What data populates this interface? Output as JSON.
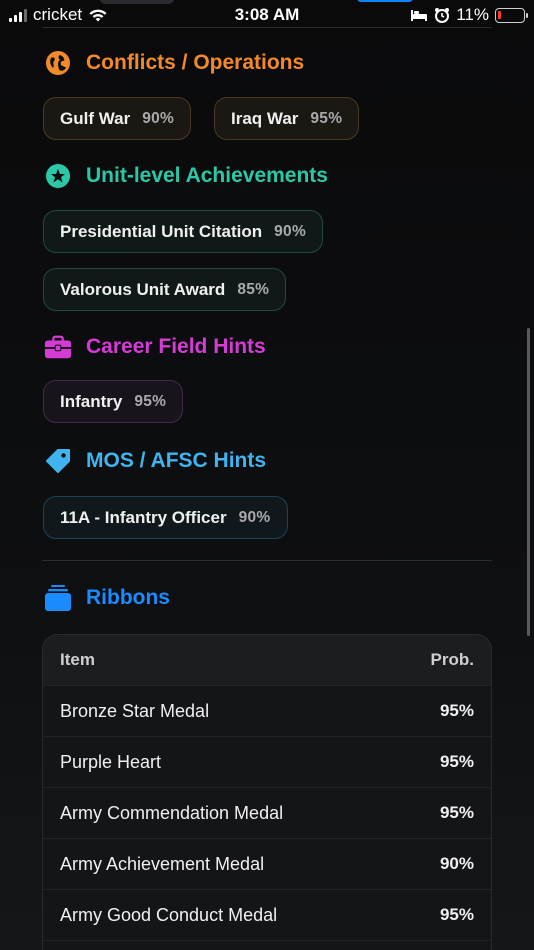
{
  "status_bar": {
    "carrier": "cricket",
    "time": "3:08 AM",
    "battery": "11%",
    "battery_level": 0.11
  },
  "sections": {
    "conflicts": {
      "title": "Conflicts / Operations",
      "icon": "globe-icon",
      "color": "#f2892b",
      "chips": [
        {
          "label": "Gulf War",
          "pct": "90%"
        },
        {
          "label": "Iraq War",
          "pct": "95%"
        }
      ]
    },
    "unit": {
      "title": "Unit-level Achievements",
      "icon": "star-circle-icon",
      "color": "#2bc8a8",
      "chips": [
        {
          "label": "Presidential Unit Citation",
          "pct": "90%"
        },
        {
          "label": "Valorous Unit Award",
          "pct": "85%"
        }
      ]
    },
    "career": {
      "title": "Career Field Hints",
      "icon": "briefcase-icon",
      "color": "#d63bd6",
      "chips": [
        {
          "label": "Infantry",
          "pct": "95%"
        }
      ]
    },
    "mos": {
      "title": "MOS / AFSC Hints",
      "icon": "tag-icon",
      "color": "#3fb4ef",
      "chips": [
        {
          "label": "11A - Infantry Officer",
          "pct": "90%"
        }
      ]
    },
    "ribbons": {
      "title": "Ribbons",
      "icon": "stack-icon",
      "color": "#1a8cff"
    }
  },
  "table": {
    "headers": {
      "item": "Item",
      "prob": "Prob."
    },
    "rows": [
      {
        "item": "Bronze Star Medal",
        "prob": "95%"
      },
      {
        "item": "Purple Heart",
        "prob": "95%"
      },
      {
        "item": "Army Commendation Medal",
        "prob": "95%"
      },
      {
        "item": "Army Achievement Medal",
        "prob": "90%"
      },
      {
        "item": "Army Good Conduct Medal",
        "prob": "95%"
      }
    ]
  }
}
